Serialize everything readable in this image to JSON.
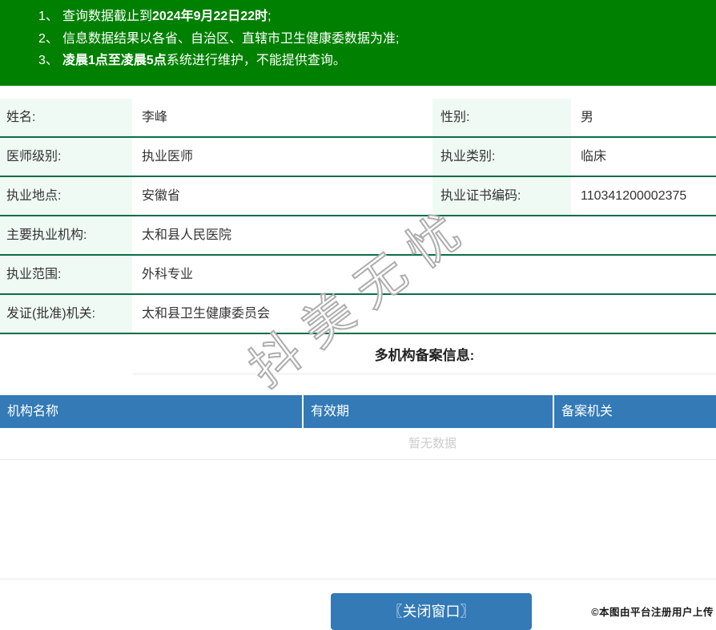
{
  "notice": {
    "lines": [
      {
        "num": "1、",
        "pre": "查询数据截止到",
        "bold": "2024年9月22日22时",
        "post": ";"
      },
      {
        "num": "2、",
        "pre": "信息数据结果以各省、自治区、直辖市卫生健康委数据为准;",
        "bold": "",
        "post": ""
      },
      {
        "num": "3、",
        "pre": "",
        "bold": "凌晨1点至凌晨5点",
        "post": "系统进行维护，不能提供查询。"
      }
    ]
  },
  "profile": {
    "rows": [
      {
        "label": "姓名:",
        "value": "李峰",
        "label2": "性别:",
        "value2": "男"
      },
      {
        "label": "医师级别:",
        "value": "执业医师",
        "label2": "执业类别:",
        "value2": "临床"
      },
      {
        "label": "执业地点:",
        "value": "安徽省",
        "label2": "执业证书编码:",
        "value2": "110341200002375"
      },
      {
        "label": "主要执业机构:",
        "value": "太和县人民医院"
      },
      {
        "label": "执业范围:",
        "value": "外科专业"
      },
      {
        "label": "发证(批准)机关:",
        "value": "太和县卫生健康委员会"
      }
    ]
  },
  "multi_org": {
    "title": "多机构备案信息:",
    "columns": [
      "机构名称",
      "有效期",
      "备案机关"
    ],
    "empty_text": "暂无数据"
  },
  "footer": {
    "close_button": "〖关闭窗口〗",
    "copyright": "©本图由平台注册用户上传"
  },
  "watermark": {
    "text": "抖美无忧"
  },
  "colors": {
    "banner_green": "#008000",
    "row_border_green": "#0b6e47",
    "label_mint": "#f0faf4",
    "table_header_blue": "#337ab7",
    "button_blue": "#337ab7"
  }
}
